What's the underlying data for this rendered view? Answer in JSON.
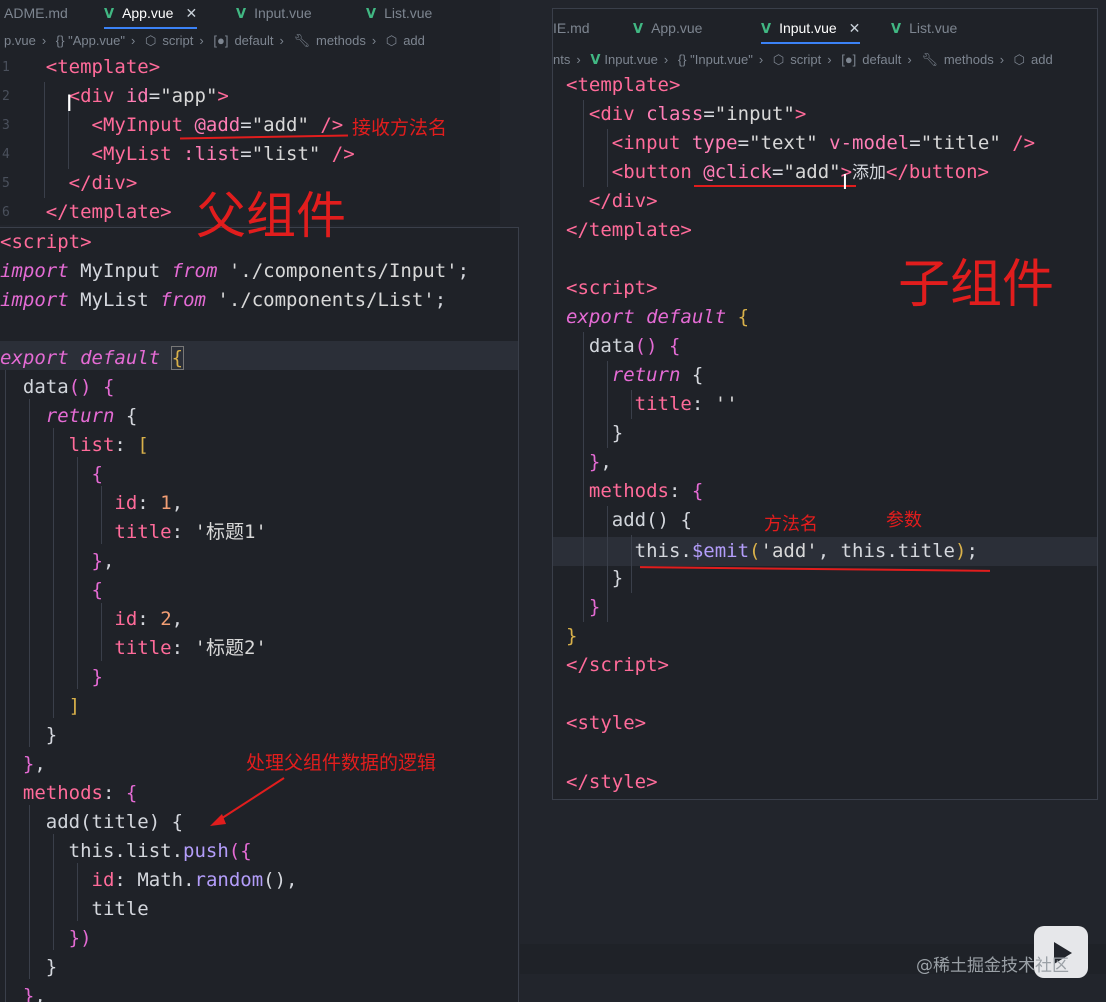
{
  "left_top": {
    "tabs": [
      {
        "label": "ADME.md",
        "active": false
      },
      {
        "label": "App.vue",
        "active": true
      },
      {
        "label": "Input.vue",
        "active": false
      },
      {
        "label": "List.vue",
        "active": false
      }
    ],
    "breadcrumb": [
      "p.vue",
      "{} \"App.vue\"",
      "script",
      "default",
      "methods",
      "add"
    ],
    "lines": [
      "1",
      "2",
      "3",
      "4",
      "5",
      "6"
    ]
  },
  "right": {
    "tabs": [
      {
        "label": "IE.md",
        "active": false
      },
      {
        "label": "App.vue",
        "active": false
      },
      {
        "label": "Input.vue",
        "active": true
      },
      {
        "label": "List.vue",
        "active": false
      }
    ],
    "breadcrumb": [
      "nts",
      "Input.vue",
      "{} \"Input.vue\"",
      "script",
      "default",
      "methods",
      "add"
    ]
  },
  "annotations": {
    "receive_method_name": "接收方法名",
    "parent_component": "父组件",
    "child_component": "子组件",
    "method_name": "方法名",
    "params": "参数",
    "parent_logic": "处理父组件数据的逻辑"
  },
  "code_text": {
    "title1": "'标题1'",
    "title2": "'标题2'",
    "add_btn": "添加"
  },
  "watermark": "@稀土掘金技术社区"
}
